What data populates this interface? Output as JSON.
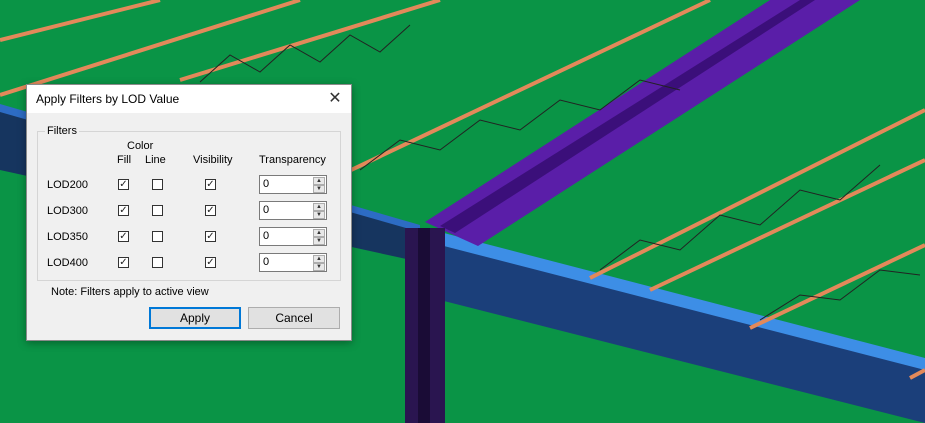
{
  "dialog": {
    "title": "Apply Filters by LOD Value",
    "close_glyph": "✕",
    "group_label": "Filters",
    "headers": {
      "color": "Color",
      "fill": "Fill",
      "line": "Line",
      "visibility": "Visibility",
      "transparency": "Transparency"
    },
    "rows": [
      {
        "label": "LOD200",
        "fill": true,
        "line": false,
        "visibility": true,
        "transparency": "0"
      },
      {
        "label": "LOD300",
        "fill": true,
        "line": false,
        "visibility": true,
        "transparency": "0"
      },
      {
        "label": "LOD350",
        "fill": true,
        "line": false,
        "visibility": true,
        "transparency": "0"
      },
      {
        "label": "LOD400",
        "fill": true,
        "line": false,
        "visibility": true,
        "transparency": "0"
      }
    ],
    "note": "Note: Filters apply to active view",
    "apply_label": "Apply",
    "cancel_label": "Cancel"
  },
  "scene": {
    "floor_color": "#0a9446",
    "joist_color": "#e3895a",
    "beam_color": "#1b3f7a",
    "girder_color": "#5a1ea8",
    "column_color": "#2a1550"
  }
}
